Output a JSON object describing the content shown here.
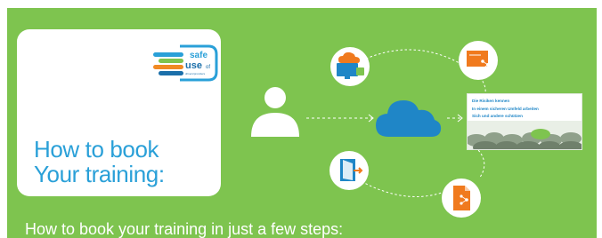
{
  "logo": {
    "line1": "safe",
    "line2": "use",
    "line3": "of",
    "line4": "drivers/providers",
    "colors": [
      "#2aa0d8",
      "#7ec44f",
      "#f08a24",
      "#1b6faa"
    ]
  },
  "card": {
    "title_line1": "How to book",
    "title_line2": "Your training:"
  },
  "steps_heading": "How to book your training in just a few steps:",
  "diagram": {
    "person_icon": "person-icon",
    "center_icon": "cloud-icon",
    "nodes": [
      {
        "icon": "monitor-cloud-icon",
        "color": "#1f86c7"
      },
      {
        "icon": "share-presentation-icon",
        "color": "#f07a1e"
      },
      {
        "icon": "exit-door-icon",
        "color": "#1f86c7"
      },
      {
        "icon": "share-document-icon",
        "color": "#f07a1e"
      }
    ],
    "slide": {
      "line1": "Die Risiken kennen",
      "line2": "In einem sicheren Umfeld arbeiten",
      "line3": "Sich und andere schützen"
    }
  },
  "colors": {
    "background": "#7ec44f",
    "card": "#ffffff",
    "title": "#2aa0d8",
    "accent_blue": "#1f86c7",
    "accent_orange": "#f07a1e"
  }
}
